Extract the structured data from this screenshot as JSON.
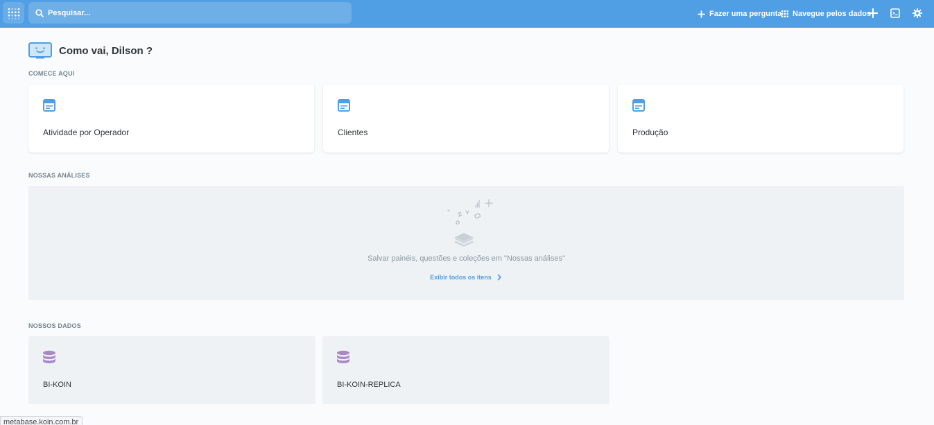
{
  "navbar": {
    "search_placeholder": "Pesquisar...",
    "ask_question_label": "Fazer uma pergunta",
    "browse_data_label": "Navegue pelos dados",
    "colors": {
      "bar": "#509ee3",
      "text": "#ffffff"
    }
  },
  "greeting": {
    "text": "Como vai, Dilson ?"
  },
  "start_here": {
    "label": "COMECE AQUI",
    "cards": [
      {
        "title": "Atividade por Operador",
        "icon": "dashboard-icon"
      },
      {
        "title": "Clientes",
        "icon": "dashboard-icon"
      },
      {
        "title": "Produção",
        "icon": "dashboard-icon"
      }
    ]
  },
  "our_analytics": {
    "label": "NOSSAS ANÁLISES",
    "empty_text": "Salvar painéis, questões e coleções em \"Nossas análises\"",
    "view_all_label": "Exibir todos os itens"
  },
  "our_data": {
    "label": "NOSSOS DADOS",
    "databases": [
      {
        "name": "BI-KOIN",
        "icon": "database-icon"
      },
      {
        "name": "BI-KOIN-REPLICA",
        "icon": "database-icon"
      }
    ]
  },
  "status_bar": {
    "url": "metabase.koin.com.br"
  },
  "colors": {
    "brand": "#509ee3",
    "database": "#a989c5",
    "muted": "#74838f"
  }
}
